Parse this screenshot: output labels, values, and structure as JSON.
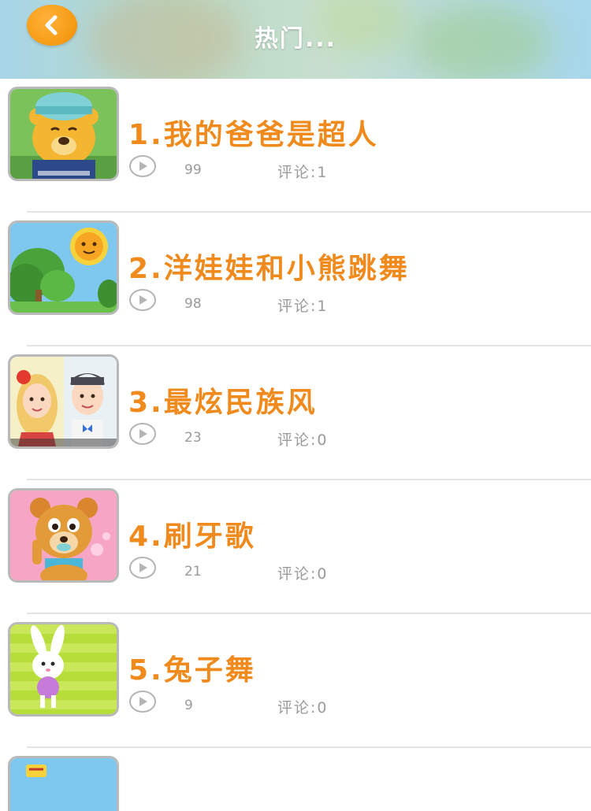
{
  "header": {
    "title": "热门...",
    "back_icon": "chevron-left-icon",
    "accent": "#f59a12"
  },
  "items": [
    {
      "title": "1.我的爸爸是超人",
      "plays": "99",
      "comments": "评论:1",
      "thumb_icon": "bear-with-hat-thumbnail"
    },
    {
      "title": "2.洋娃娃和小熊跳舞",
      "plays": "98",
      "comments": "评论:1",
      "thumb_icon": "sun-and-trees-thumbnail"
    },
    {
      "title": "3.最炫民族风",
      "plays": "23",
      "comments": "评论:0",
      "thumb_icon": "couple-thumbnail"
    },
    {
      "title": "4.刷牙歌",
      "plays": "21",
      "comments": "评论:0",
      "thumb_icon": "bear-brushing-teeth-thumbnail"
    },
    {
      "title": "5.兔子舞",
      "plays": "9",
      "comments": "评论:0",
      "thumb_icon": "bunny-thumbnail"
    }
  ],
  "colors": {
    "title": "#f08a1c",
    "meta_text": "#9a9a9a",
    "divider": "#e4e4e4"
  }
}
